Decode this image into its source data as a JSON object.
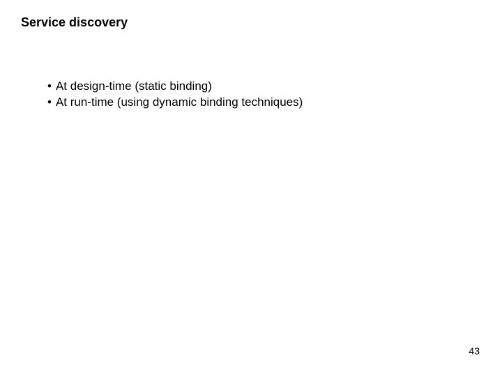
{
  "title": "Service discovery",
  "bullets": [
    "At design-time (static binding)",
    "At run-time (using dynamic binding techniques)"
  ],
  "pageNumber": "43"
}
